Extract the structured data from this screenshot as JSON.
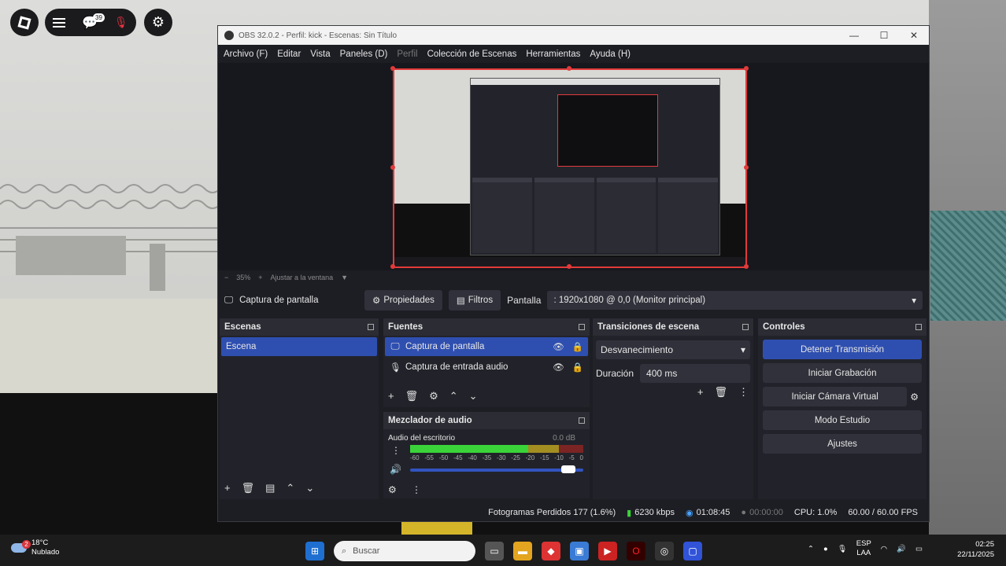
{
  "roblox": {
    "notification_count": "39"
  },
  "obs": {
    "title": "OBS 32.0.2 - Perfil: kick - Escenas: Sin Título",
    "menu": [
      "Archivo (F)",
      "Editar",
      "Vista",
      "Paneles (D)",
      "Perfil",
      "Colección de Escenas",
      "Herramientas",
      "Ayuda (H)"
    ],
    "zoom": {
      "value": "35%",
      "fit_label": "Ajustar a la ventana"
    },
    "source_bar": {
      "source_name": "Captura de pantalla",
      "properties": "Propiedades",
      "filters": "Filtros",
      "screen_label": "Pantalla",
      "screen_value": ": 1920x1080 @ 0,0 (Monitor principal)"
    },
    "scenes": {
      "title": "Escenas",
      "items": [
        "Escena"
      ]
    },
    "sources": {
      "title": "Fuentes",
      "items": [
        "Captura de pantalla",
        "Captura de entrada audio"
      ]
    },
    "mixer": {
      "title": "Mezclador de audio",
      "channel": "Audio del escritorio",
      "db": "0.0 dB",
      "level": 0.68,
      "scale": [
        "-60",
        "-55",
        "-50",
        "-45",
        "-40",
        "-35",
        "-30",
        "-25",
        "-20",
        "-15",
        "-10",
        "-5",
        "0"
      ]
    },
    "transitions": {
      "title": "Transiciones de escena",
      "type": "Desvanecimiento",
      "duration_label": "Duración",
      "duration": "400 ms"
    },
    "controls": {
      "title": "Controles",
      "stop_stream": "Detener Transmisión",
      "start_recording": "Iniciar Grabación",
      "virtual_cam": "Iniciar Cámara Virtual",
      "studio_mode": "Modo Estudio",
      "settings": "Ajustes"
    },
    "status": {
      "dropped_frames": "Fotogramas Perdidos 177 (1.6%)",
      "bitrate": "6230 kbps",
      "stream_time": "01:08:45",
      "rec_time": "00:00:00",
      "cpu": "CPU: 1.0%",
      "fps": "60.00 / 60.00 FPS"
    }
  },
  "taskbar": {
    "weather_temp": "18°C",
    "weather_desc": "Nublado",
    "weather_badge": "2",
    "search_placeholder": "Buscar",
    "lang_1": "ESP",
    "lang_2": "LAA",
    "time": "02:25",
    "date": "22/11/2025"
  },
  "colors": {
    "accent": "#2f4fb0",
    "record_red": "#e23a3a",
    "meter_green": "#3ad33a"
  }
}
